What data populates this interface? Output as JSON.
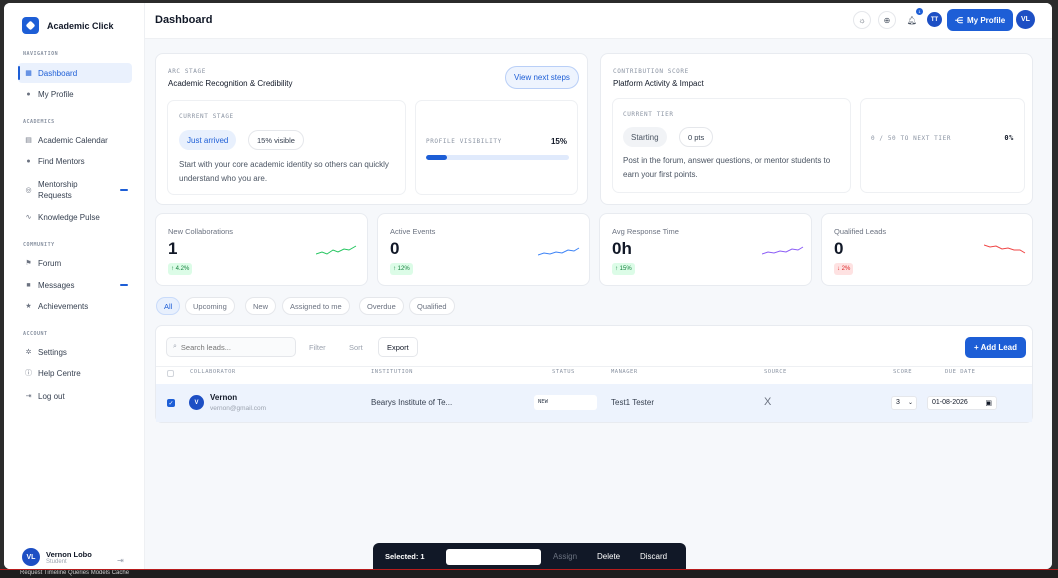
{
  "brand": {
    "name": "Academic Click"
  },
  "sidebar": {
    "sections": [
      {
        "title": "NAVIGATION",
        "items": [
          {
            "label": "Dashboard",
            "icon": "grid-icon"
          },
          {
            "label": "My Profile",
            "icon": "user-icon"
          }
        ]
      },
      {
        "title": "ACADEMICS",
        "items": [
          {
            "label": "Academic Calendar",
            "icon": "calendar-icon"
          },
          {
            "label": "Find Mentors",
            "icon": "user-search-icon"
          },
          {
            "label": "Mentorship Requests",
            "icon": "target-icon"
          },
          {
            "label": "Knowledge Pulse",
            "icon": "pulse-icon"
          }
        ]
      },
      {
        "title": "COMMUNITY",
        "items": [
          {
            "label": "Forum",
            "icon": "flag-icon"
          },
          {
            "label": "Messages",
            "icon": "chat-icon"
          },
          {
            "label": "Achievements",
            "icon": "star-icon"
          }
        ]
      },
      {
        "title": "ACCOUNT",
        "items": [
          {
            "label": "Settings",
            "icon": "gear-icon"
          },
          {
            "label": "Help Centre",
            "icon": "help-icon"
          },
          {
            "label": "Log out",
            "icon": "logout-icon"
          }
        ]
      }
    ],
    "user": {
      "initials": "VL",
      "name": "Vernon Lobo",
      "role": "Student"
    }
  },
  "header": {
    "title": "Dashboard",
    "notifications_count": "1",
    "user_initials_tt": "TT",
    "profile_button": "My Profile",
    "avatar_initials": "VL"
  },
  "arc": {
    "label": "ARC STAGE",
    "subtitle": "Academic Recognition & Credibility",
    "view_button": "View next steps",
    "current_label": "CURRENT STAGE",
    "stage": "Just arrived",
    "visible": "15% visible",
    "description": "Start with your core academic identity so others can quickly understand who you are.",
    "visibility_label": "PROFILE VISIBILITY",
    "visibility_value": "15%",
    "visibility_fraction": 0.15
  },
  "contribution": {
    "label": "CONTRIBUTION SCORE",
    "subtitle": "Platform Activity & Impact",
    "tier_label": "CURRENT TIER",
    "tier": "Starting",
    "points": "0 pts",
    "description": "Post in the forum, answer questions, or mentor students to earn your first points.",
    "next_label": "0 / 50 TO NEXT TIER",
    "next_value": "0%"
  },
  "stats": [
    {
      "title": "New Collaborations",
      "value": "1",
      "delta": "↑ 4.2%",
      "trend": "up",
      "color": "#22c55e"
    },
    {
      "title": "Active Events",
      "value": "0",
      "delta": "↑ 12%",
      "trend": "up",
      "color": "#3b82f6"
    },
    {
      "title": "Avg Response Time",
      "value": "0h",
      "delta": "↑ 15%",
      "trend": "up",
      "color": "#8b5cf6"
    },
    {
      "title": "Qualified Leads",
      "value": "0",
      "delta": "↓ 2%",
      "trend": "down",
      "color": "#ef4444"
    }
  ],
  "filters": [
    "All",
    "Upcoming",
    "New",
    "Assigned to me",
    "Overdue",
    "Qualified"
  ],
  "toolbar": {
    "search_placeholder": "Search leads...",
    "filter": "Filter",
    "sort": "Sort",
    "export": "Export",
    "add_lead": "+ Add Lead"
  },
  "table": {
    "headers": [
      "COLLABORATOR",
      "INSTITUTION",
      "STATUS",
      "MANAGER",
      "SOURCE",
      "SCORE",
      "DUE DATE"
    ],
    "rows": [
      {
        "initial": "V",
        "name": "Vernon",
        "email": "vernon@gmail.com",
        "institution": "Bearys Institute of Te...",
        "status": "NEW",
        "manager": "Test1 Tester",
        "source": "X",
        "score": "3",
        "due": "01-08-2026"
      }
    ]
  },
  "bulk": {
    "selected": "Selected: 1",
    "assign": "Assign",
    "delete": "Delete",
    "discard": "Discard"
  },
  "devtools": {
    "text": "Request  Timeline  Queries  Models  Cache"
  }
}
